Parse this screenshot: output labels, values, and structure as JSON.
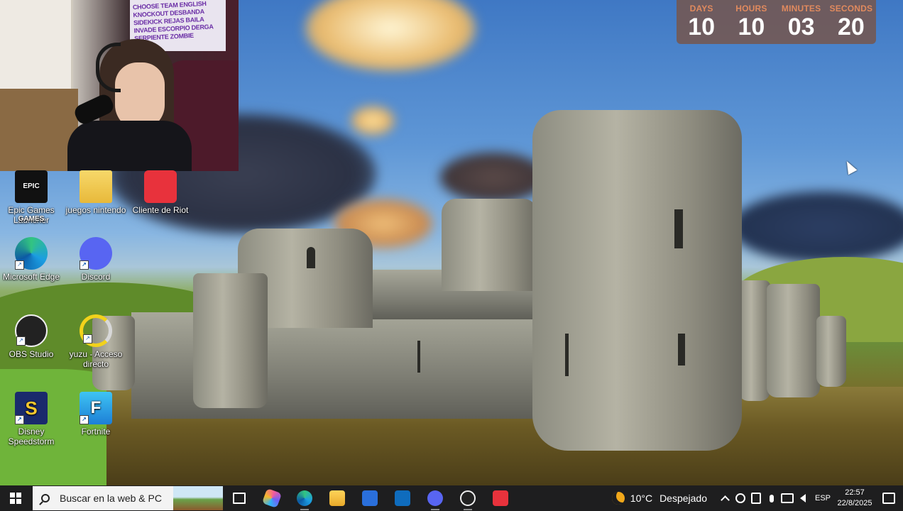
{
  "countdown": {
    "days_label": "DAYS",
    "days": "10",
    "hours_label": "HOURS",
    "hours": "10",
    "minutes_label": "MINUTES",
    "minutes": "03",
    "seconds_label": "SECONDS",
    "seconds": "20"
  },
  "webcam": {
    "poster_text": "CHOOSE TEAM ENGLISH KNOCKOUT DESBANDA SIDEKICK REJAS BAILA INVADE ESCORPIO DERGA SERPIENTE ZOMBIE"
  },
  "desktop_icons": [
    {
      "label": "Epic Games Launcher",
      "icon": "epic-games-icon",
      "badge": "EPIC GAMES"
    },
    {
      "label": "juegos nintendo",
      "icon": "folder-icon"
    },
    {
      "label": "Cliente de Riot",
      "icon": "riot-client-icon"
    },
    {
      "label": "Microsoft Edge",
      "icon": "edge-icon"
    },
    {
      "label": "Discord",
      "icon": "discord-icon"
    },
    {
      "label": "OBS Studio",
      "icon": "obs-icon"
    },
    {
      "label": "yuzu - Acceso directo",
      "icon": "yuzu-icon"
    },
    {
      "label": "Disney Speedstorm",
      "icon": "disney-speedstorm-icon"
    },
    {
      "label": "Fortnite",
      "icon": "fortnite-icon",
      "badge": "F"
    }
  ],
  "taskbar": {
    "search_placeholder": "Buscar en la web & PC",
    "pinned": [
      "task-view-icon",
      "copilot-icon",
      "edge-icon",
      "file-explorer-icon",
      "microsoft-store-icon",
      "outlook-icon",
      "discord-icon",
      "obs-icon",
      "valorant-icon"
    ],
    "weather": {
      "temperature": "10°C",
      "condition": "Despejado"
    },
    "language": "ESP",
    "time": "22:57",
    "date": "22/8/2025"
  },
  "colors": {
    "countdown_bg": "#785448",
    "countdown_label": "#e08a5e",
    "taskbar_bg": "#1e1e1f"
  }
}
